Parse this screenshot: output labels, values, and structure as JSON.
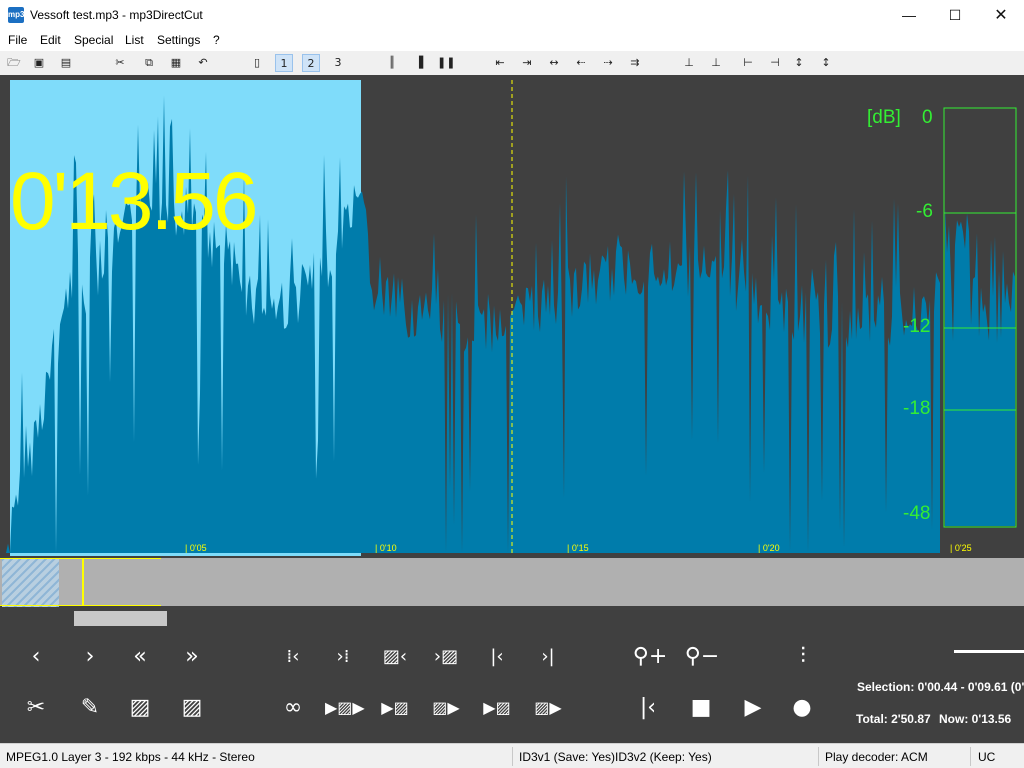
{
  "window": {
    "title": "Vessoft test.mp3 - mp3DirectCut",
    "app_icon": "mp3",
    "minimize": "—",
    "maximize": "☐",
    "close": "✕"
  },
  "menu": [
    "File",
    "Edit",
    "Special",
    "List",
    "Settings",
    "?"
  ],
  "toolbar_icons": [
    "open-icon",
    "save-icon",
    "save-as-icon",
    "cut-icon",
    "copy-icon",
    "paste-icon",
    "undo-icon",
    "page-icon",
    "page-1-icon",
    "page-2-icon",
    "page-3-icon",
    "split-icon",
    "bar-icon",
    "pause-icon",
    "set-begin-icon",
    "set-end-icon",
    "move-icon",
    "move-begin-icon",
    "move-end-icon",
    "cue-left-icon",
    "cue-right-icon",
    "marker-1-icon",
    "marker-2-icon",
    "marker-3-icon",
    "marker-4-icon"
  ],
  "waveform": {
    "current_time": "0'13.56",
    "time_ticks": [
      "0'05",
      "0'10",
      "0'15",
      "0'20",
      "0'25"
    ],
    "db_unit": "[dB]",
    "db_labels": [
      "0",
      "-6",
      "-12",
      "-18",
      "-48"
    ],
    "colors": {
      "background": "#404040",
      "wave": "#007cab",
      "selection": "#7fdcfa",
      "cursor": "#ffff00",
      "meter": "#33ee33"
    }
  },
  "controls": {
    "selection": "Selection: 0'00.44 - 0'09.61 (0'",
    "total": "Total: 2'50.87",
    "now": "Now: 0'13.56"
  },
  "status": {
    "format": "MPEG1.0 Layer 3 - 192 kbps - 44 kHz - Stereo",
    "id3v1": "ID3v1 (Save: Yes)",
    "id3v2": "ID3v2 (Keep: Yes)",
    "decoder": "Play decoder: ACM",
    "mode": "UC"
  }
}
